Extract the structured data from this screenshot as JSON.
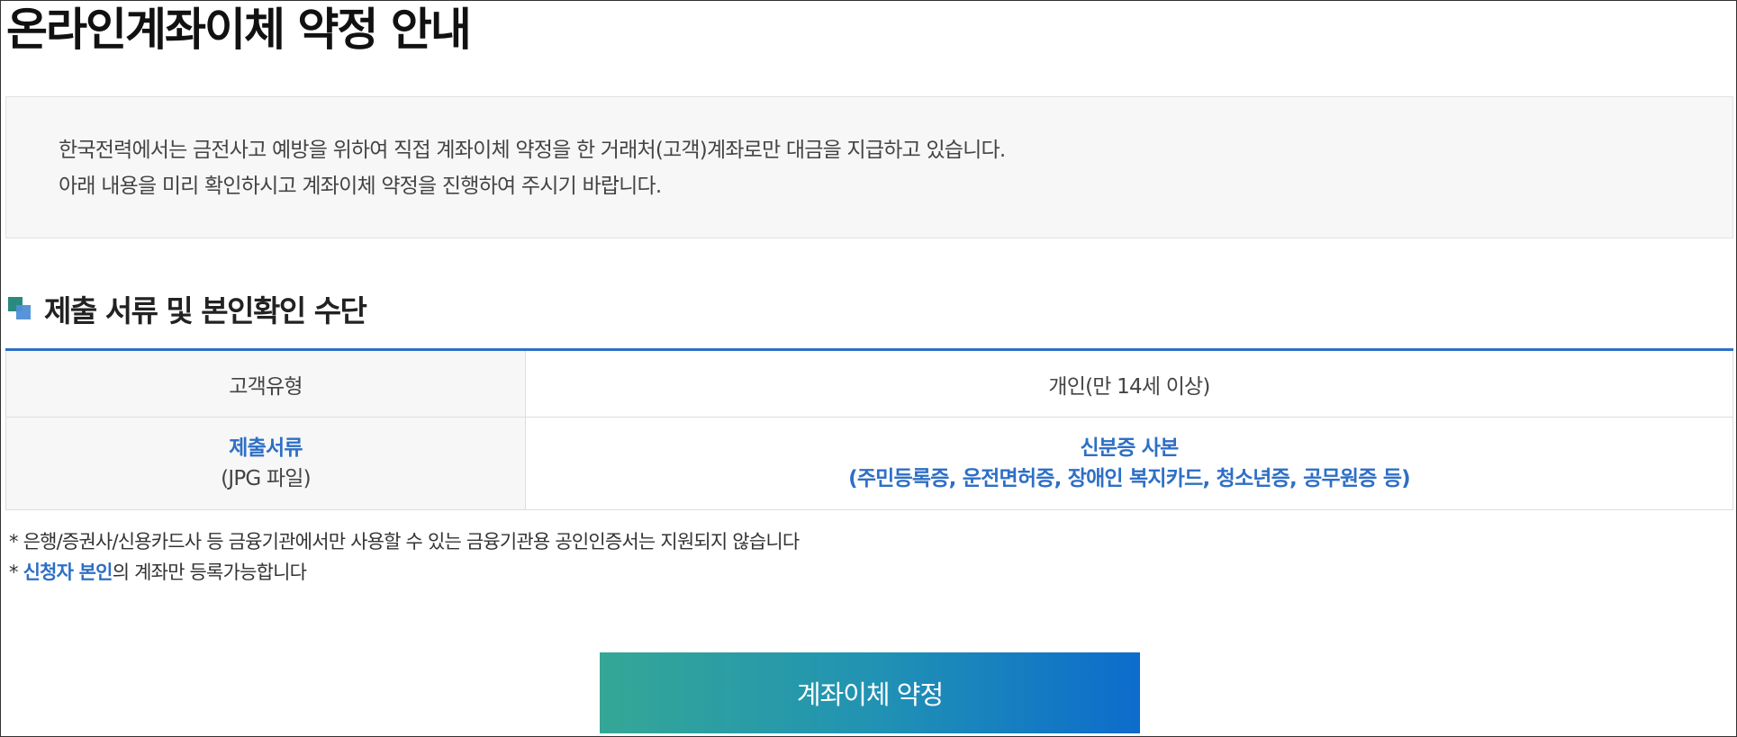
{
  "page": {
    "title": "온라인계좌이체 약정 안내"
  },
  "notice": {
    "line1": "한국전력에서는 금전사고 예방을 위하여 직접 계좌이체 약정을 한 거래처(고객)계좌로만 대금을 지급하고 있습니다.",
    "line2": "아래 내용을 미리 확인하시고 계좌이체 약정을 진행하여 주시기 바랍니다."
  },
  "section": {
    "title": "제출 서류 및 본인확인 수단",
    "icon": "stacked-squares-icon"
  },
  "table": {
    "rows": [
      {
        "label": "고객유형",
        "value": "개인(만 14세 이상)"
      },
      {
        "label": "제출서류",
        "label_sub": "(JPG 파일)",
        "value": "신분증 사본",
        "value_sub": "(주민등록증, 운전면허증, 장애인 복지카드, 청소년증, 공무원증 등)"
      }
    ]
  },
  "notes": {
    "note1": "* 은행/증권사/신용카드사 등 금융기관에서만 사용할 수 있는 금융기관용 공인인증서는 지원되지 않습니다",
    "note2_prefix": "* ",
    "note2_highlight": "신청자 본인",
    "note2_suffix": "의 계좌만 등록가능합니다"
  },
  "button": {
    "label": "계좌이체 약정"
  },
  "colors": {
    "accent_blue": "#2e6fc6",
    "icon_green": "#2a8a7e",
    "icon_blue": "#4f8fd6",
    "button_gradient_start": "#35a796",
    "button_gradient_end": "#0d6ccc"
  }
}
